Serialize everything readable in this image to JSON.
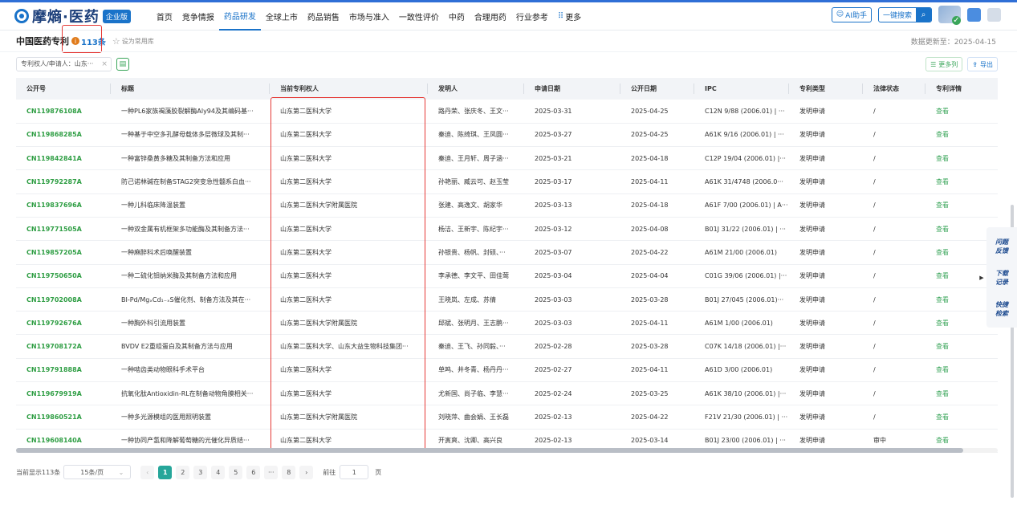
{
  "brand": {
    "name": "摩熵·医药",
    "badge": "企业版"
  },
  "nav": {
    "items": [
      "首页",
      "竞争情报",
      "药品研发",
      "全球上市",
      "药品销售",
      "市场与准入",
      "一致性评价",
      "中药",
      "合理用药",
      "行业参考"
    ],
    "active_index": 2,
    "more_label": "更多",
    "ai_label": "AI助手",
    "search_label": "一键搜索"
  },
  "header": {
    "title": "中国医药专利",
    "count": "113条",
    "favorite_label": "设为常用库",
    "update_text": "数据更新至：2025-04-15"
  },
  "filter": {
    "chip_label": "专利权人/申请人：山东···",
    "more_columns": "更多列",
    "export": "导出"
  },
  "table": {
    "columns": [
      "公开号",
      "标题",
      "当前专利权人",
      "发明人",
      "申请日期",
      "公开日期",
      "IPC",
      "专利类型",
      "法律状态",
      "专利详情"
    ],
    "rows": [
      [
        "CN119876108A",
        "一种PL6家族褐藻胶裂解酶Aly94及其编码基···",
        "山东第二医科大学",
        "路丹荣、张庆冬、王文···",
        "2025-03-31",
        "2025-04-25",
        "C12N 9/88 (2006.01) | ···",
        "发明申请",
        "/",
        "查看"
      ],
      [
        "CN119868285A",
        "一种基于中空多孔酵母载体多层微球及其制···",
        "山东第二医科大学",
        "秦迪、陈绮琪、王凤圆···",
        "2025-03-27",
        "2025-04-25",
        "A61K 9/16 (2006.01) | ···",
        "发明申请",
        "/",
        "查看"
      ],
      [
        "CN119842841A",
        "一种富锌桑黄多糖及其制备方法和应用",
        "山东第二医科大学",
        "秦迪、王月轩、周子涵···",
        "2025-03-21",
        "2025-04-18",
        "C12P 19/04 (2006.01) |···",
        "发明申请",
        "/",
        "查看"
      ],
      [
        "CN119792287A",
        "防己诺林碱在制备STAG2突变急性髓系白血···",
        "山东第二医科大学",
        "孙艳丽、臧云可、赵玉莹",
        "2025-03-17",
        "2025-04-11",
        "A61K 31/4748 (2006.0···",
        "发明申请",
        "/",
        "查看"
      ],
      [
        "CN119837696A",
        "一种儿科临床降温装置",
        "山东第二医科大学附属医院",
        "张建、高逸文、胡家华",
        "2025-03-13",
        "2025-04-18",
        "A61F 7/00 (2006.01) | A···",
        "发明申请",
        "/",
        "查看"
      ],
      [
        "CN119771505A",
        "一种双金属有机框架多功能酶及其制备方法···",
        "山东第二医科大学",
        "杨洁、王新宇、陈纪宇···",
        "2025-03-12",
        "2025-04-08",
        "B01J 31/22 (2006.01) | ···",
        "发明申请",
        "/",
        "查看"
      ],
      [
        "CN119857205A",
        "一种麻醉科术后唤醒装置",
        "山东第二医科大学",
        "孙银贵、杨帆、封硕、···",
        "2025-03-07",
        "2025-04-22",
        "A61M 21/00 (2006.01)",
        "发明申请",
        "/",
        "查看"
      ],
      [
        "CN119750650A",
        "一种二硫化钼纳米酶及其制备方法和应用",
        "山东第二医科大学",
        "李承德、李文平、田佳莺",
        "2025-03-04",
        "2025-04-04",
        "C01G 39/06 (2006.01) |···",
        "发明申请",
        "/",
        "查看"
      ],
      [
        "CN119702008A",
        "BI-Pd/MgₓCd₁₋ₓS催化剂、制备方法及其在···",
        "山东第二医科大学",
        "王晓岚、左成、苏倩",
        "2025-03-03",
        "2025-03-28",
        "B01J 27/045 (2006.01)···",
        "发明申请",
        "/",
        "查看"
      ],
      [
        "CN119792676A",
        "一种胸外科引流用装置",
        "山东第二医科大学附属医院",
        "邱斌、张明月、王志鹏···",
        "2025-03-03",
        "2025-04-11",
        "A61M 1/00 (2006.01)",
        "发明申请",
        "/",
        "查看"
      ],
      [
        "CN119708172A",
        "BVDV E2重组蛋白及其制备方法与应用",
        "山东第二医科大学、山东大益生物科技集团···",
        "秦迪、王飞、孙同毅、···",
        "2025-02-28",
        "2025-03-28",
        "C07K 14/18 (2006.01) |···",
        "发明申请",
        "/",
        "查看"
      ],
      [
        "CN119791888A",
        "一种啮齿类动物眼科手术平台",
        "山东第二医科大学",
        "单鸣、井冬青、杨丹丹···",
        "2025-02-27",
        "2025-04-11",
        "A61D 3/00 (2006.01)",
        "发明申请",
        "/",
        "查看"
      ],
      [
        "CN119679919A",
        "抗氧化肽Antioxidin-RL在制备动物角膜相关···",
        "山东第二医科大学",
        "尤新国、尚子临、李慧···",
        "2025-02-24",
        "2025-03-25",
        "A61K 38/10 (2006.01) |···",
        "发明申请",
        "/",
        "查看"
      ],
      [
        "CN119860521A",
        "一种多光源模组的医用照明装置",
        "山东第二医科大学附属医院",
        "刘晓萍、曲会娟、王长磊",
        "2025-02-13",
        "2025-04-22",
        "F21V 21/30 (2006.01) | ···",
        "发明申请",
        "/",
        "查看"
      ],
      [
        "CN119608140A",
        "一种协同产氢和降解葡萄糖的光催化异质结···",
        "山东第二医科大学",
        "开寅爽、沈卿、高兴良",
        "2025-02-13",
        "2025-03-14",
        "B01J 23/00 (2006.01) | ···",
        "发明申请",
        "审中",
        "查看"
      ]
    ]
  },
  "pagination": {
    "summary": "当前显示113条",
    "page_size": "15条/页",
    "pages": [
      "1",
      "2",
      "3",
      "4",
      "5",
      "6",
      "···",
      "8"
    ],
    "goto_label": "前往",
    "goto_value": "1",
    "page_unit": "页"
  },
  "side_panel": {
    "feedback": "问题反馈",
    "download": "下载记录",
    "quick_search": "快捷检索"
  },
  "colors": {
    "accent": "#1a73c9",
    "link_green": "#2f9e44",
    "highlight_red": "#e53935",
    "active_page": "#26a69a"
  }
}
